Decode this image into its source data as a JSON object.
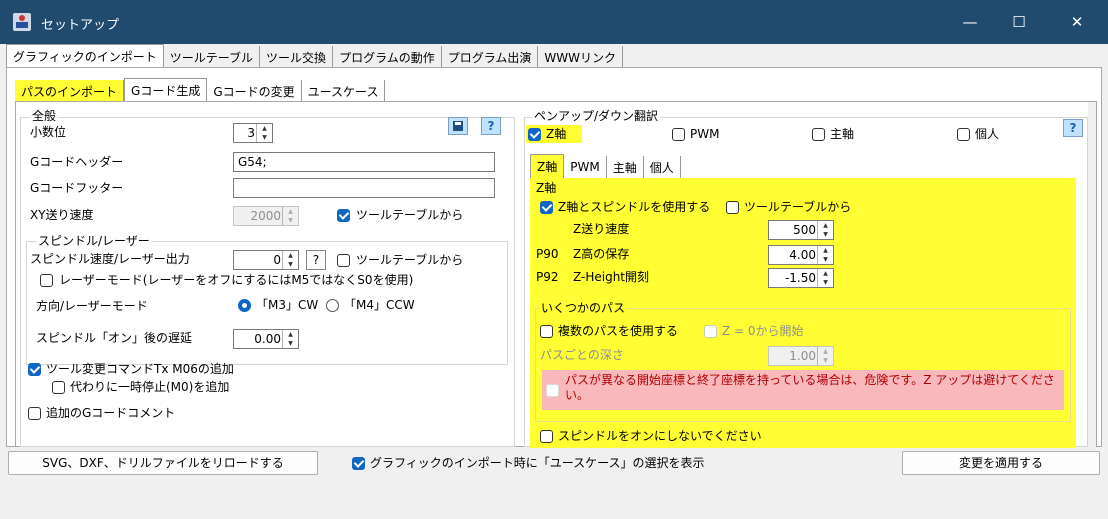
{
  "window": {
    "title": "セットアップ",
    "minimize": "—",
    "maximize": "☐",
    "close": "✕"
  },
  "main_tabs": [
    "グラフィックのインポート",
    "ツールテーブル",
    "ツール交換",
    "プログラムの動作",
    "プログラム出演",
    "WWWリンク"
  ],
  "sub_tabs": [
    "パスのインポート",
    "Gコード生成",
    "Gコードの変更",
    "ユースケース"
  ],
  "general": {
    "title": "全般",
    "decimals_label": "小数位",
    "decimals_value": "3",
    "header_label": "Gコードヘッダー",
    "header_value": "G54;",
    "footer_label": "Gコードフッター",
    "footer_value": "",
    "xy_feed_label": "XY送り速度",
    "xy_feed_value": "2000",
    "from_tool_table": "ツールテーブルから",
    "help": "?"
  },
  "spindle": {
    "title": "スピンドル/レーザー",
    "speed_label": "スピンドル速度/レーザー出力",
    "speed_value": "0",
    "speed_help": "?",
    "from_tool_table": "ツールテーブルから",
    "laser_mode": "レーザーモード(レーザーをオフにするにはM5ではなくS0を使用)",
    "direction_label": "方向/レーザーモード",
    "cw": "「M3」CW",
    "ccw": "「M4」CCW",
    "delay_label": "スピンドル「オン」後の遅延",
    "delay_value": "0.00"
  },
  "tool_change": {
    "add_m06": "ツール変更コマンドTx M06の追加",
    "pause_m0": "代わりに一時停止(M0)を追加",
    "gcode_comments": "追加のGコードコメント"
  },
  "pen": {
    "title": "ペンアップ/ダウン翻訳",
    "z_axis": "Z軸",
    "pwm": "PWM",
    "spindle": "主軸",
    "individual": "個人",
    "help": "?",
    "tabs": [
      "Z軸",
      "PWM",
      "主軸",
      "個人"
    ],
    "z_group_title": "Z軸",
    "use_z_and_spindle": "Z軸とスピンドルを使用する",
    "from_tool_table": "ツールテーブルから",
    "z_feed_label": "Z送り速度",
    "z_feed_value": "500",
    "p90_code": "P90",
    "z_save_label": "Z高の保存",
    "z_save_value": "4.00",
    "p92_code": "P92",
    "z_height_label": "Z-Height開刻",
    "z_height_value": "-1.50",
    "passes_title": "いくつかのパス",
    "multi_pass": "複数のパスを使用する",
    "start_at_zero": "Z = 0から開始",
    "depth_per_pass_label": "パスごとの深さ",
    "depth_per_pass_value": "1.00",
    "warning": "パスが異なる開始座標と終了座標を持っている場合は、危険です。Z アップは避けてください。",
    "no_spindle_on": "スピンドルをオンにしないでください"
  },
  "footer": {
    "reload": "SVG、DXF、ドリルファイルをリロードする",
    "show_usecase": "グラフィックのインポート時に「ユースケース」の選択を表示",
    "apply": "変更を適用する"
  }
}
